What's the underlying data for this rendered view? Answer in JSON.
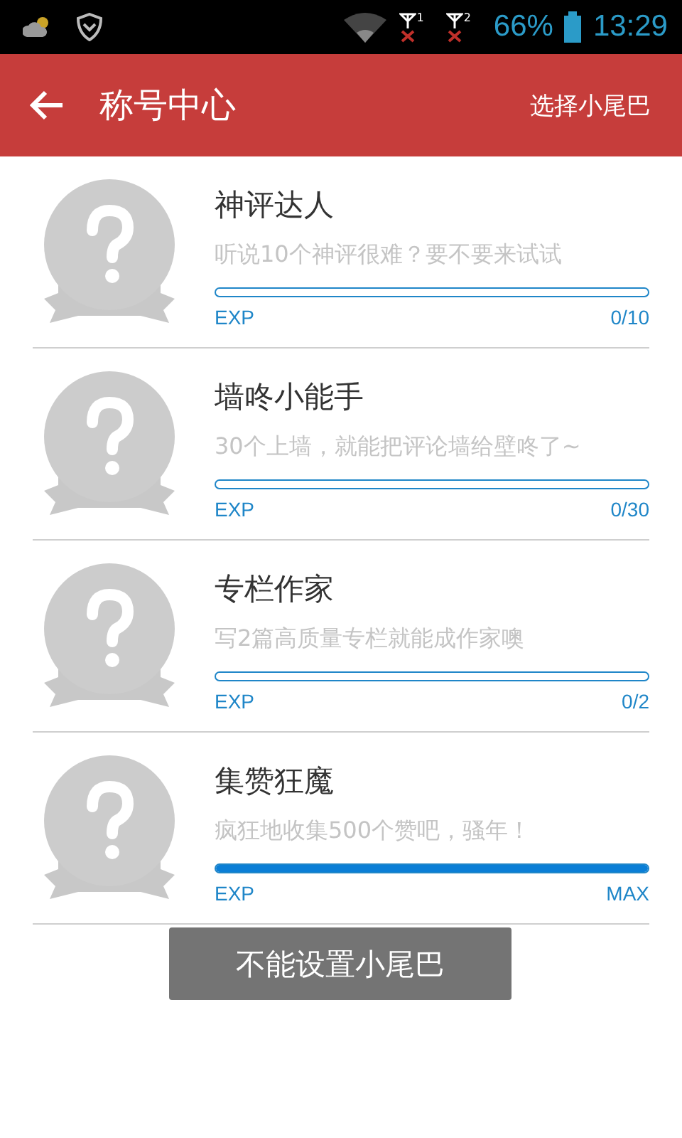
{
  "status_bar": {
    "sim_slots": [
      "1",
      "2"
    ],
    "battery": "66%",
    "time": "13:29"
  },
  "app_bar": {
    "title": "称号中心",
    "action": "选择小尾巴"
  },
  "titles": [
    {
      "name": "神评达人",
      "description": "听说10个神评很难？要不要来试试",
      "level": 0,
      "exp_label": "EXP",
      "progress": "0/10"
    },
    {
      "name": "墙咚小能手",
      "description": "30个上墙，就能把评论墙给壁咚了~",
      "level": 0,
      "exp_label": "EXP",
      "progress": "0/30"
    },
    {
      "name": "专栏作家",
      "description": "写2篇高质量专栏就能成作家噢",
      "level": 0,
      "exp_label": "EXP",
      "progress": "0/2"
    },
    {
      "name": "集赞狂魔",
      "description": "疯狂地收集500个赞吧，骚年！",
      "level": 1,
      "exp_label": "EXP",
      "progress": "MAX"
    }
  ],
  "toast": "不能设置小尾巴"
}
